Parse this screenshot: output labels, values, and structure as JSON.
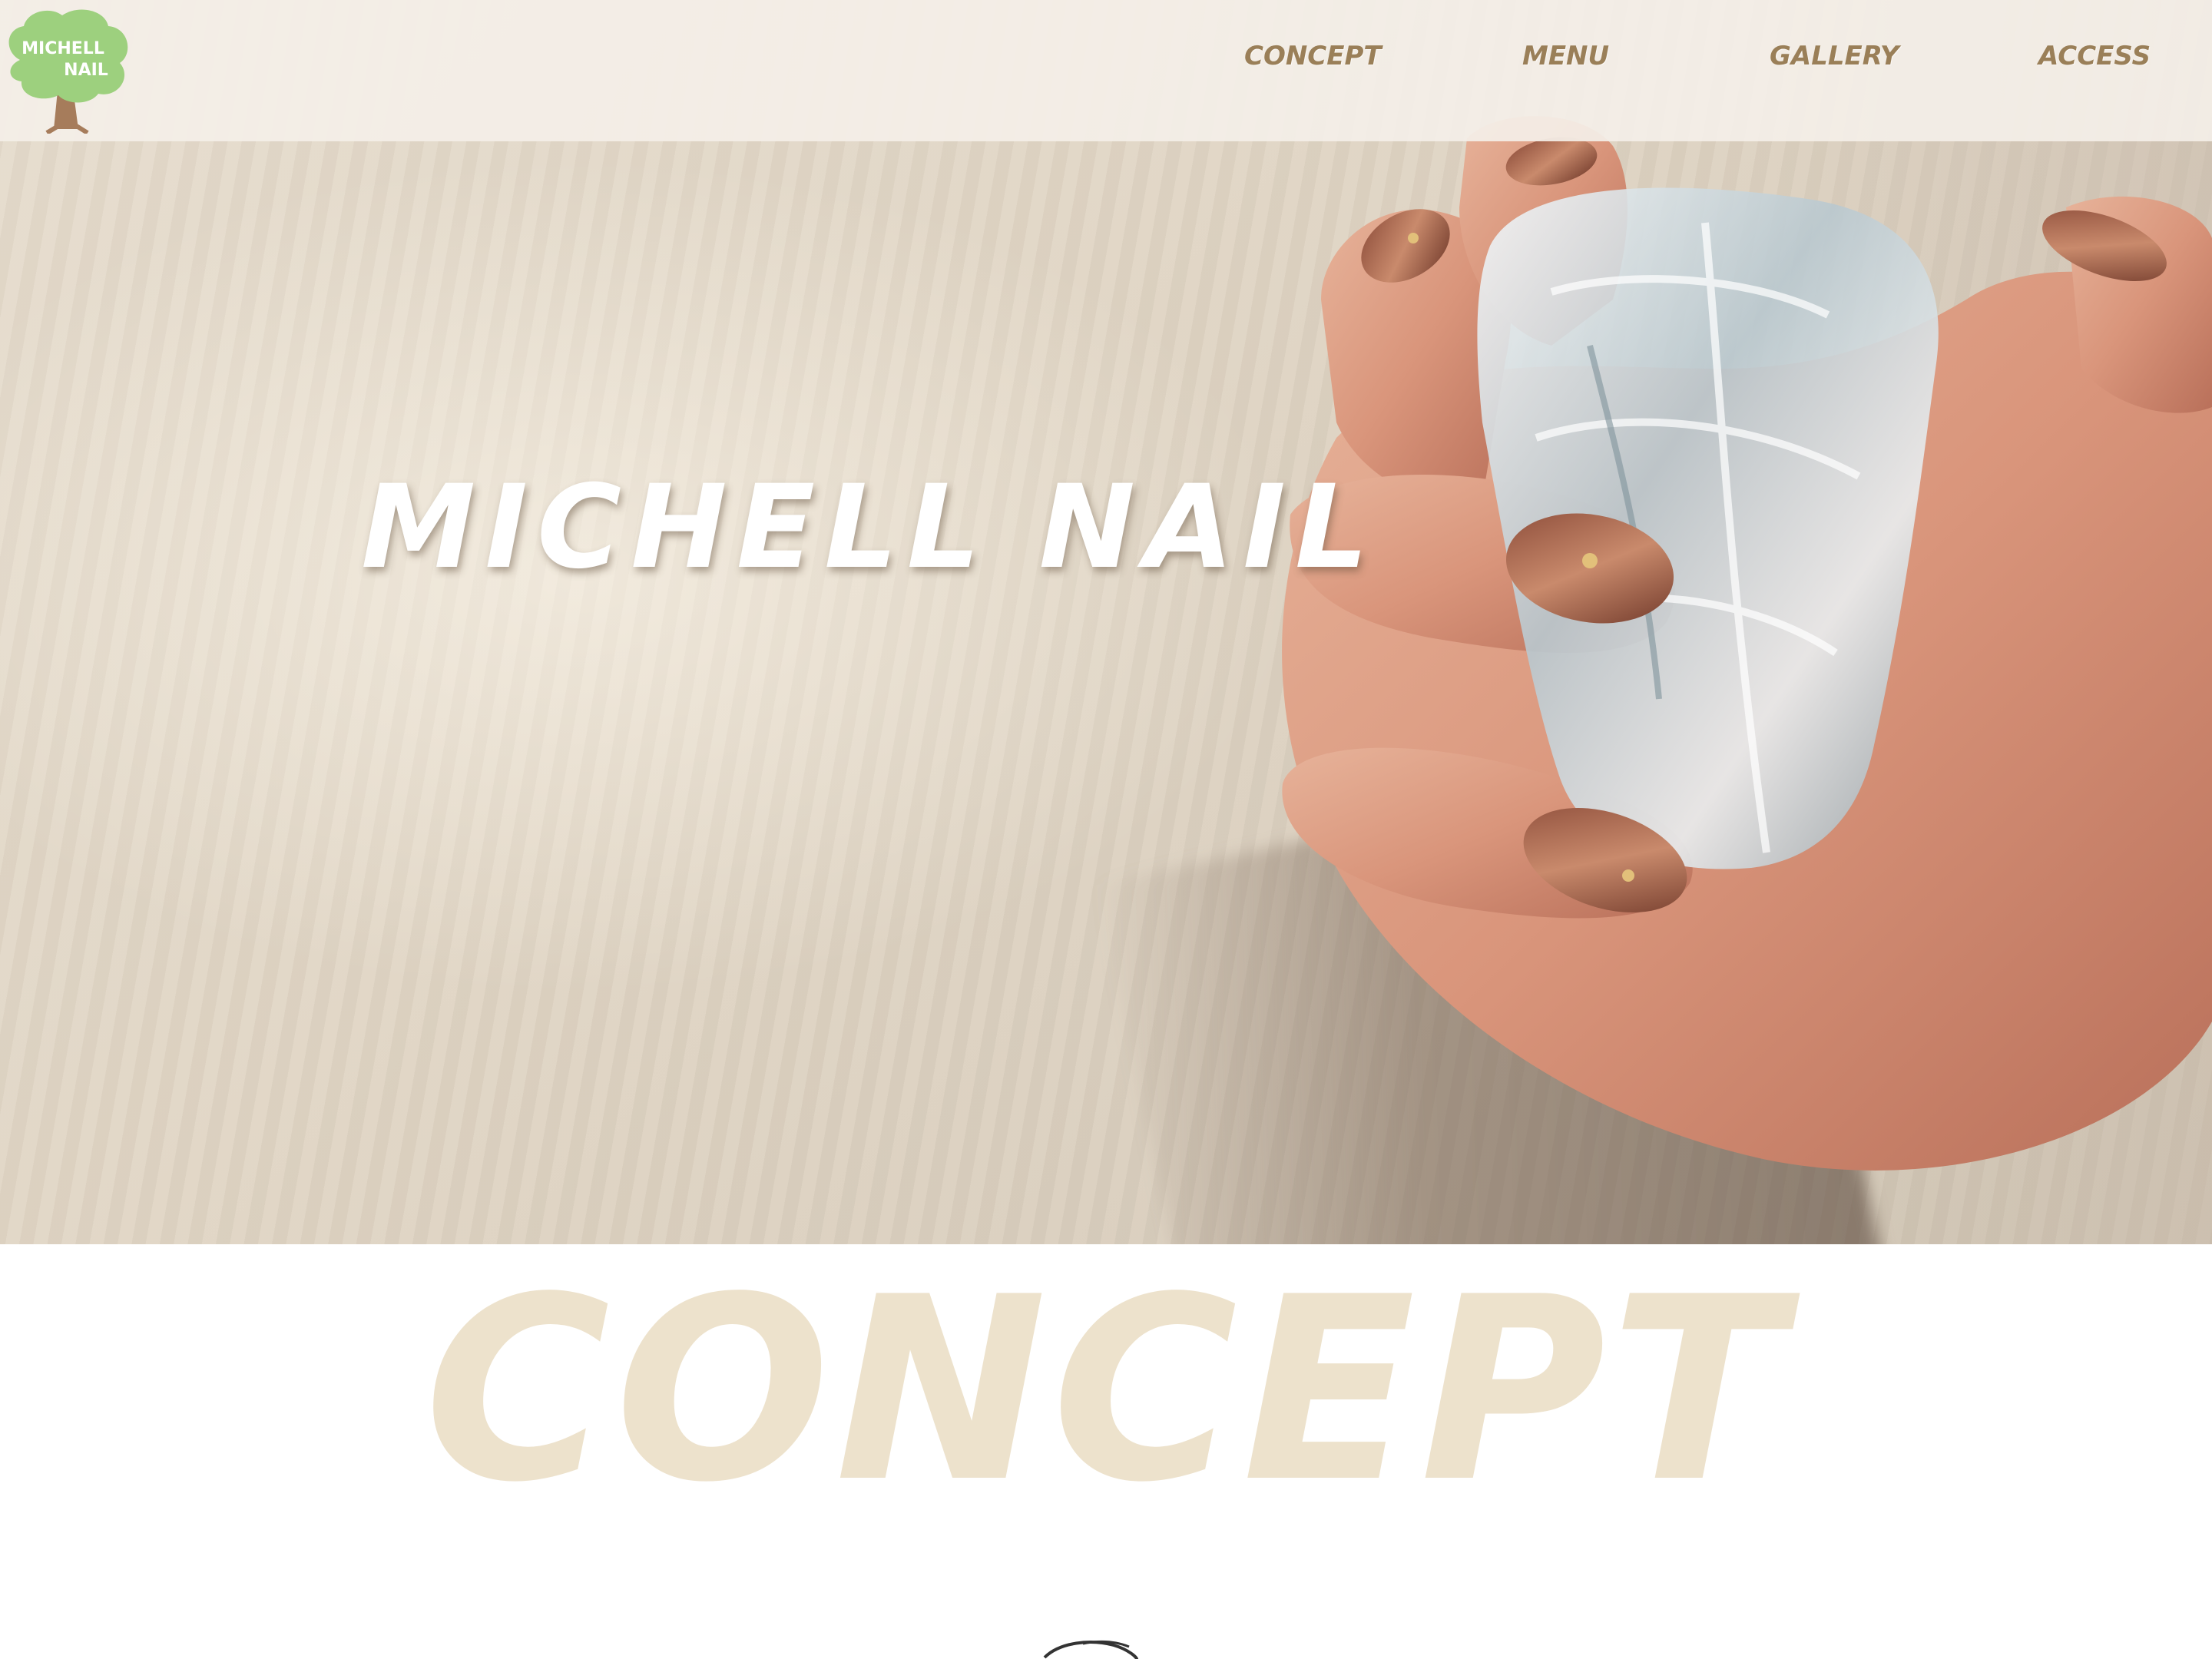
{
  "brand": {
    "logo_line1": "MICHELL",
    "logo_line2": "NAIL"
  },
  "nav": {
    "items": [
      {
        "label": "CONCEPT"
      },
      {
        "label": "MENU"
      },
      {
        "label": "GALLERY"
      },
      {
        "label": "ACCESS"
      }
    ]
  },
  "hero": {
    "title": "MICHELL NAIL"
  },
  "concept": {
    "heading": "CONCEPT"
  },
  "colors": {
    "nav_text": "#9a7f58",
    "header_bg": "#f4efe8",
    "logo_green": "#9dd07e",
    "logo_trunk": "#a67c5b",
    "concept_heading": "#ede2cc"
  },
  "icons": {
    "logo": "tree-logo-icon"
  }
}
